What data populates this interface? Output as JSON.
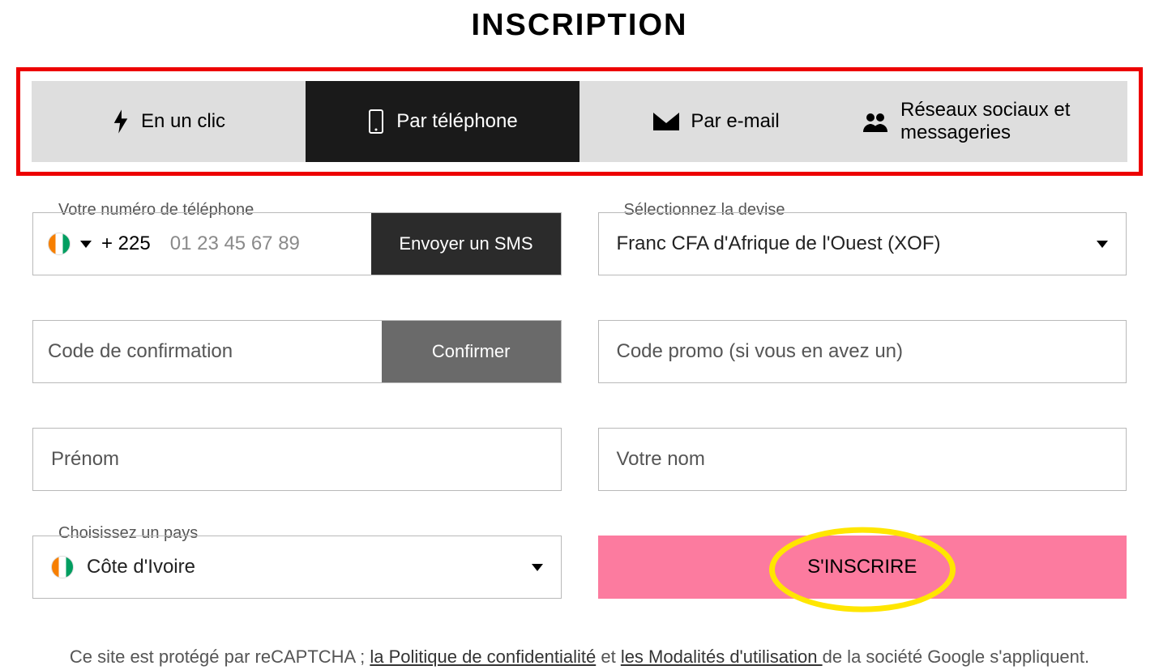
{
  "title": "INSCRIPTION",
  "tabs": {
    "one_click": "En un clic",
    "phone": "Par téléphone",
    "email": "Par e-mail",
    "social": "Réseaux sociaux et messageries",
    "active_index": 1
  },
  "phone": {
    "label": "Votre numéro de téléphone",
    "dial_code": "+ 225",
    "placeholder": "01 23 45 67 89",
    "sms_button": "Envoyer un SMS"
  },
  "currency": {
    "label": "Sélectionnez la devise",
    "value": "Franc CFA d'Afrique de l'Ouest (XOF)"
  },
  "confirm": {
    "placeholder": "Code de confirmation",
    "button": "Confirmer"
  },
  "promo": {
    "placeholder": "Code promo (si vous en avez un)"
  },
  "firstname": {
    "placeholder": "Prénom"
  },
  "lastname": {
    "placeholder": "Votre nom"
  },
  "country": {
    "label": "Choisissez un pays",
    "value": "Côte d'Ivoire"
  },
  "submit": {
    "label": "S'INSCRIRE"
  },
  "disclaimer": {
    "prefix": "Ce site est protégé par reCAPTCHA ; ",
    "link1": "la Politique de confidentialité",
    "mid": " et ",
    "link2": "les Modalités d'utilisation ",
    "suffix": "de la société Google s'appliquent."
  }
}
